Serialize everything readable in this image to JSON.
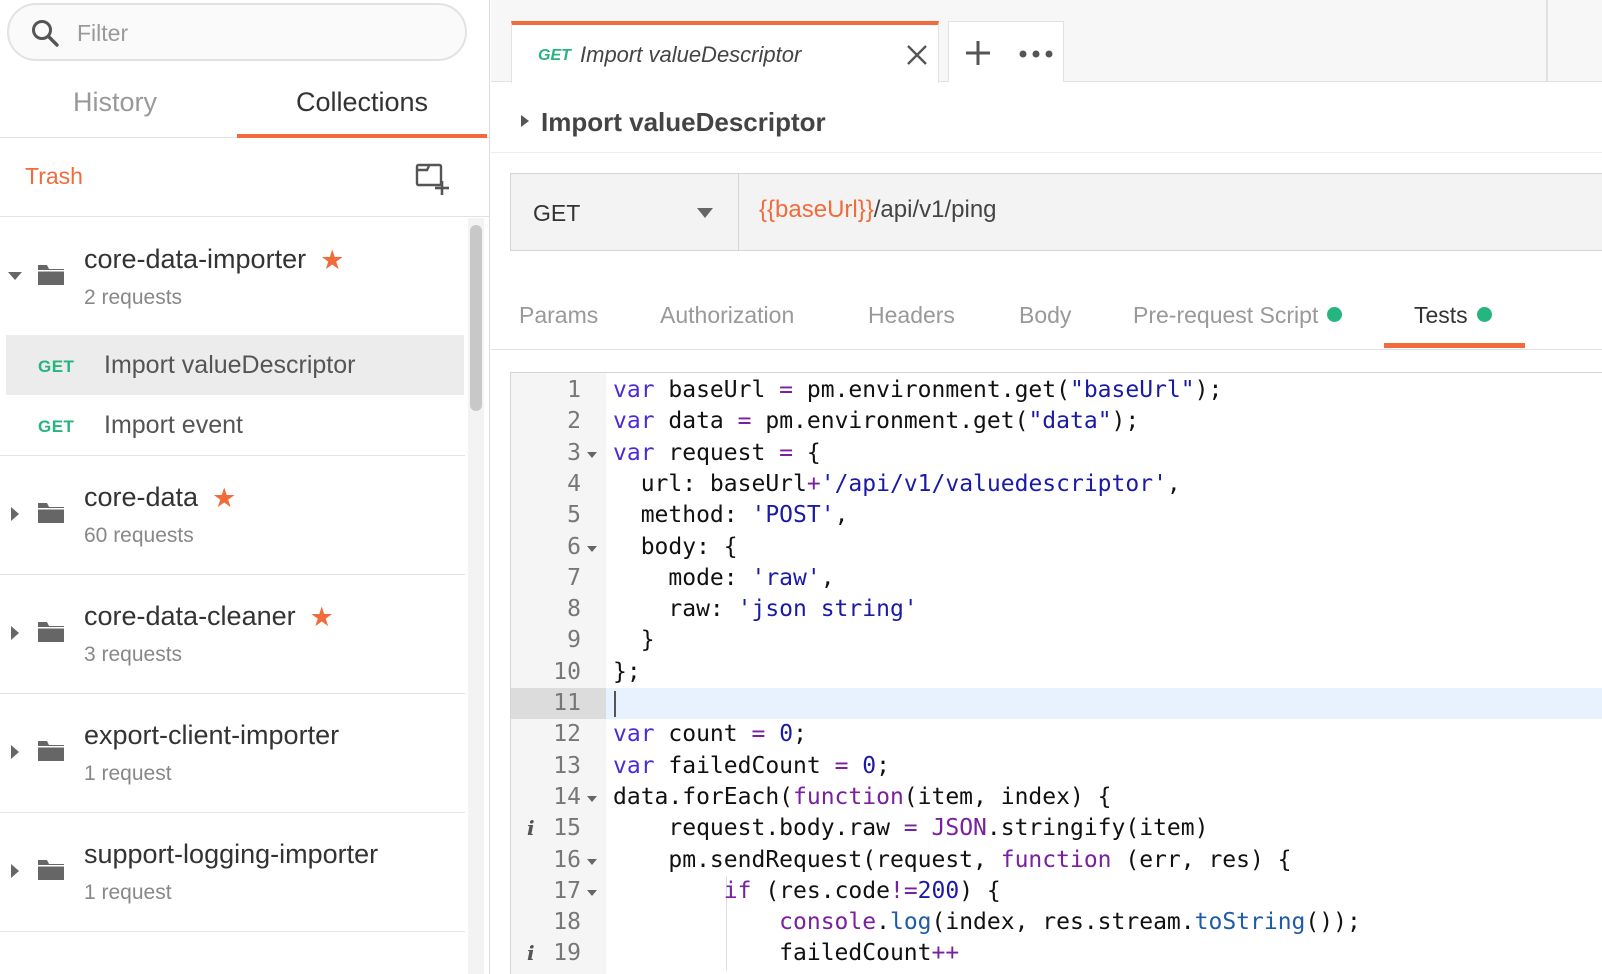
{
  "sidebar": {
    "filter_placeholder": "Filter",
    "tabs": {
      "history": "History",
      "collections": "Collections"
    },
    "trash": "Trash",
    "collections": [
      {
        "name": "core-data-importer",
        "count": "2 requests",
        "starred": true,
        "expanded": true,
        "requests": [
          {
            "method": "GET",
            "name": "Import valueDescriptor",
            "selected": true
          },
          {
            "method": "GET",
            "name": "Import event",
            "selected": false
          }
        ]
      },
      {
        "name": "core-data",
        "count": "60 requests",
        "starred": true
      },
      {
        "name": "core-data-cleaner",
        "count": "3 requests",
        "starred": true
      },
      {
        "name": "export-client-importer",
        "count": "1 request",
        "starred": false
      },
      {
        "name": "support-logging-importer",
        "count": "1 request",
        "starred": false
      }
    ]
  },
  "tab": {
    "method": "GET",
    "name": "Import valueDescriptor"
  },
  "request": {
    "title": "Import valueDescriptor",
    "method": "GET",
    "url_var": "{{baseUrl}}",
    "url_path": "/api/v1/ping"
  },
  "request_tabs": {
    "params": "Params",
    "authorization": "Authorization",
    "headers": "Headers",
    "body": "Body",
    "prerequest": "Pre-request Script",
    "tests": "Tests"
  },
  "editor": {
    "active_line": 11,
    "lines": [
      "var baseUrl = pm.environment.get(\"baseUrl\");",
      "var data = pm.environment.get(\"data\");",
      "var request = {",
      "  url: baseUrl+'/api/v1/valuedescriptor',",
      "  method: 'POST',",
      "  body: {",
      "    mode: 'raw',",
      "    raw: 'json string'",
      "  }",
      "};",
      "",
      "var count = 0;",
      "var failedCount = 0;",
      "data.forEach(function(item, index) {",
      "    request.body.raw = JSON.stringify(item)",
      "    pm.sendRequest(request, function (err, res) {",
      "        if (res.code!=200) {",
      "            console.log(index, res.stream.toString());",
      "            failedCount++"
    ],
    "line_numbers": [
      "1",
      "2",
      "3",
      "4",
      "5",
      "6",
      "7",
      "8",
      "9",
      "10",
      "11",
      "12",
      "13",
      "14",
      "15",
      "16",
      "17",
      "18",
      "19"
    ]
  },
  "colors": {
    "accent": "#f26b3a",
    "get": "#26b47f"
  }
}
